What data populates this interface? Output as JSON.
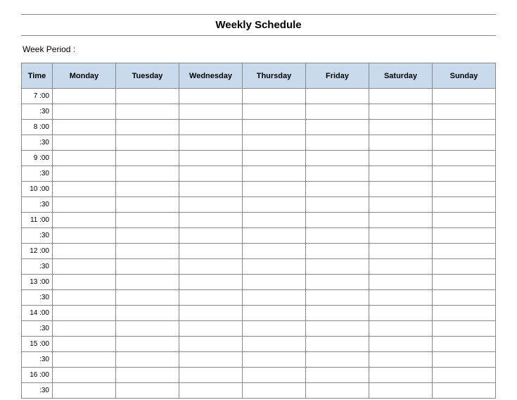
{
  "title": "Weekly Schedule",
  "week_period_label": "Week  Period :",
  "headers": {
    "time": "Time",
    "days": [
      "Monday",
      "Tuesday",
      "Wednesday",
      "Thursday",
      "Friday",
      "Saturday",
      "Sunday"
    ]
  },
  "time_rows": [
    "7  :00",
    ":30",
    "8  :00",
    ":30",
    "9  :00",
    ":30",
    "10  :00",
    ":30",
    "11  :00",
    ":30",
    "12  :00",
    ":30",
    "13  :00",
    ":30",
    "14  :00",
    ":30",
    "15  :00",
    ":30",
    "16  :00",
    ":30"
  ],
  "solid_border_days": 2,
  "dotted_border_days": 5
}
